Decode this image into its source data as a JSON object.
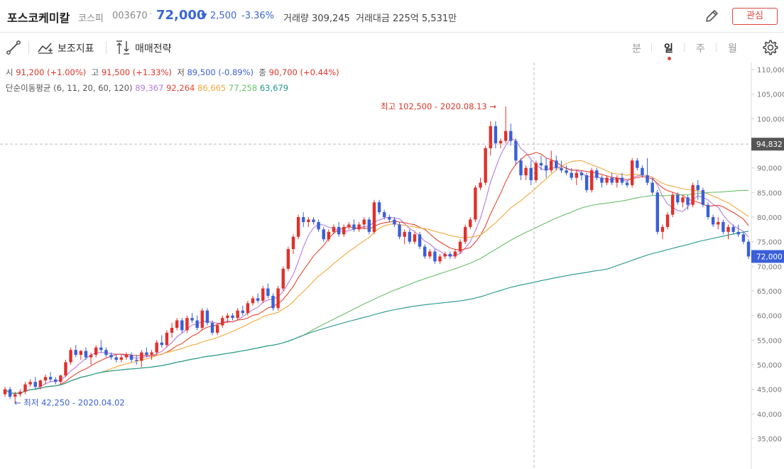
{
  "header": {
    "name": "포스코케미칼",
    "market": "코스피",
    "code": "003670",
    "separator": "·",
    "price": "72,000",
    "down_arrow": "▼",
    "change": "2,500",
    "change_pct": "-3.36%",
    "volume_label": "거래량",
    "volume": "309,245",
    "amount_label": "거래대금",
    "amount": "225억 5,531만",
    "favorite_label": "관심",
    "edit_icon": "pencil-icon"
  },
  "toolbar": {
    "draw_icon": "line-draw-icon",
    "indicator_label": "보조지표",
    "strategy_label": "매매전략",
    "periods": [
      {
        "label": "분",
        "selected": false
      },
      {
        "label": "일",
        "selected": true
      },
      {
        "label": "주",
        "selected": false
      },
      {
        "label": "월",
        "selected": false
      }
    ],
    "settings_icon": "gear-icon"
  },
  "ohlc": {
    "open_label": "시",
    "open": "91,200 (+1.00%)",
    "high_label": "고",
    "high": "91,500 (+1.33%)",
    "low_label": "저",
    "low": "89,500 (-0.89%)",
    "close_label": "종",
    "close": "90,700 (+0.44%)"
  },
  "ma": {
    "label": "단순이동평균 (6, 11, 20, 60, 120)",
    "values": [
      {
        "value": "89,367",
        "color": "#b57bde"
      },
      {
        "value": "92,264",
        "color": "#e8452e"
      },
      {
        "value": "86,665",
        "color": "#f2a93b"
      },
      {
        "value": "77,258",
        "color": "#6abf69"
      },
      {
        "value": "63,679",
        "color": "#1f968b"
      }
    ]
  },
  "colors": {
    "up": "#e0312b",
    "down": "#3a5fd8",
    "grid": "#e8e8e8"
  },
  "chart_data": {
    "type": "candlestick",
    "ylim": [
      34000,
      111000
    ],
    "yticks": [
      35000,
      40000,
      45000,
      50000,
      55000,
      60000,
      65000,
      70000,
      75000,
      80000,
      85000,
      90000,
      95000,
      100000,
      105000,
      110000
    ],
    "crosshair_price": 94832,
    "crosshair_label": "94,832",
    "last_price": 72000,
    "last_label": "72,000",
    "max_annotation": "최고 102,500 - 2020.08.13 →",
    "max_value": 102500,
    "min_annotation": "← 최저 42,250 - 2020.04.02",
    "min_value": 42250,
    "candles": [
      [
        44000,
        45500,
        43500,
        45000
      ],
      [
        45000,
        45500,
        43000,
        43500
      ],
      [
        43500,
        44500,
        42250,
        44000
      ],
      [
        44000,
        45000,
        43500,
        44500
      ],
      [
        44500,
        46500,
        44000,
        46000
      ],
      [
        46000,
        47000,
        45500,
        46500
      ],
      [
        46500,
        47500,
        45000,
        45500
      ],
      [
        45500,
        47000,
        45000,
        46800
      ],
      [
        46800,
        48000,
        46000,
        47500
      ],
      [
        47500,
        48500,
        46500,
        47000
      ],
      [
        47000,
        47500,
        46000,
        46500
      ],
      [
        46500,
        48000,
        46000,
        47800
      ],
      [
        47800,
        51000,
        47500,
        50500
      ],
      [
        50500,
        53500,
        50000,
        53000
      ],
      [
        53000,
        54000,
        51500,
        52000
      ],
      [
        52000,
        53000,
        51000,
        52800
      ],
      [
        52800,
        53500,
        51000,
        51500
      ],
      [
        51500,
        52500,
        50000,
        52000
      ],
      [
        52000,
        54000,
        51500,
        53500
      ],
      [
        53500,
        55000,
        52500,
        53000
      ],
      [
        53000,
        53500,
        51500,
        52000
      ],
      [
        52000,
        52500,
        51000,
        51500
      ],
      [
        51500,
        52000,
        50500,
        51000
      ],
      [
        51000,
        52000,
        50500,
        51500
      ],
      [
        51500,
        52500,
        51000,
        52000
      ],
      [
        52000,
        52500,
        50500,
        51000
      ],
      [
        51000,
        52000,
        50000,
        50800
      ],
      [
        50800,
        53000,
        49500,
        52500
      ],
      [
        52500,
        53500,
        51500,
        52000
      ],
      [
        52000,
        53000,
        51000,
        52500
      ],
      [
        52500,
        55000,
        52000,
        54500
      ],
      [
        54500,
        56000,
        53500,
        54000
      ],
      [
        54000,
        57000,
        53500,
        56500
      ],
      [
        56500,
        58500,
        55500,
        57500
      ],
      [
        57500,
        59500,
        57000,
        59000
      ],
      [
        59000,
        59500,
        56500,
        57000
      ],
      [
        57000,
        60000,
        56500,
        59500
      ],
      [
        59500,
        60500,
        58500,
        59000
      ],
      [
        59000,
        60000,
        57000,
        57500
      ],
      [
        57500,
        61500,
        57000,
        61000
      ],
      [
        61000,
        61500,
        58000,
        58500
      ],
      [
        58500,
        59000,
        56000,
        56500
      ],
      [
        56500,
        58500,
        56000,
        58000
      ],
      [
        58000,
        60000,
        57500,
        59500
      ],
      [
        59500,
        60500,
        58500,
        60000
      ],
      [
        60000,
        60500,
        59000,
        59500
      ],
      [
        59500,
        61500,
        59000,
        61000
      ],
      [
        61000,
        62000,
        60000,
        60500
      ],
      [
        60500,
        63000,
        60000,
        62500
      ],
      [
        62500,
        64000,
        62000,
        63500
      ],
      [
        63500,
        64500,
        62500,
        63000
      ],
      [
        63000,
        66000,
        62500,
        65500
      ],
      [
        65500,
        66500,
        63500,
        64000
      ],
      [
        64000,
        64500,
        61000,
        61500
      ],
      [
        61500,
        66000,
        61000,
        65500
      ],
      [
        65500,
        70000,
        65000,
        69500
      ],
      [
        69500,
        74000,
        69000,
        73500
      ],
      [
        73500,
        76500,
        72500,
        76000
      ],
      [
        76000,
        80500,
        75500,
        80000
      ],
      [
        80000,
        81000,
        78000,
        79000
      ],
      [
        79000,
        80000,
        78000,
        79500
      ],
      [
        79500,
        80000,
        78500,
        79000
      ],
      [
        79000,
        79500,
        77000,
        77500
      ],
      [
        77500,
        78000,
        75000,
        75500
      ],
      [
        75500,
        77500,
        75000,
        77000
      ],
      [
        77000,
        78500,
        76500,
        78000
      ],
      [
        78000,
        79000,
        76000,
        76500
      ],
      [
        76500,
        78500,
        76000,
        78000
      ],
      [
        78000,
        79000,
        77500,
        78500
      ],
      [
        78500,
        79500,
        77000,
        77500
      ],
      [
        77500,
        79000,
        77000,
        78500
      ],
      [
        78500,
        80000,
        77500,
        79500
      ],
      [
        79500,
        80000,
        76500,
        77000
      ],
      [
        77000,
        83500,
        76500,
        83000
      ],
      [
        83000,
        83500,
        80500,
        81000
      ],
      [
        81000,
        81500,
        79500,
        80000
      ],
      [
        80000,
        80500,
        79000,
        79500
      ],
      [
        79500,
        80000,
        78000,
        78500
      ],
      [
        78500,
        79000,
        75500,
        76000
      ],
      [
        76000,
        77500,
        74500,
        77000
      ],
      [
        77000,
        77500,
        74500,
        75000
      ],
      [
        75000,
        77000,
        74500,
        76500
      ],
      [
        76500,
        77000,
        73500,
        74000
      ],
      [
        74000,
        74500,
        71500,
        72000
      ],
      [
        72000,
        73500,
        71500,
        73000
      ],
      [
        73000,
        73500,
        70500,
        71000
      ],
      [
        71000,
        72500,
        70500,
        72000
      ],
      [
        72000,
        73000,
        71500,
        72500
      ],
      [
        72500,
        73000,
        71500,
        72000
      ],
      [
        72000,
        73500,
        71500,
        73000
      ],
      [
        73000,
        75500,
        72500,
        75000
      ],
      [
        75000,
        78500,
        74500,
        78000
      ],
      [
        78000,
        80000,
        77500,
        79500
      ],
      [
        79500,
        86500,
        79000,
        86000
      ],
      [
        86000,
        88000,
        85500,
        87000
      ],
      [
        87000,
        94500,
        86500,
        94000
      ],
      [
        94000,
        99500,
        92500,
        98500
      ],
      [
        98500,
        99500,
        94000,
        95000
      ],
      [
        95000,
        96000,
        94000,
        95500
      ],
      [
        95500,
        102500,
        95000,
        97500
      ],
      [
        97500,
        99000,
        94500,
        95500
      ],
      [
        95500,
        96000,
        90500,
        91500
      ],
      [
        91500,
        92000,
        87500,
        88500
      ],
      [
        88500,
        90500,
        87500,
        90000
      ],
      [
        90000,
        91500,
        86500,
        87500
      ],
      [
        87500,
        91500,
        87000,
        91000
      ],
      [
        91000,
        92500,
        89500,
        90500
      ],
      [
        90500,
        92000,
        88000,
        89500
      ],
      [
        89500,
        93500,
        89000,
        91500
      ],
      [
        91500,
        92500,
        89500,
        90000
      ],
      [
        90000,
        91500,
        89000,
        89500
      ],
      [
        89500,
        90500,
        88500,
        89000
      ],
      [
        89000,
        90000,
        87500,
        88000
      ],
      [
        88000,
        89500,
        86500,
        89000
      ],
      [
        89000,
        89500,
        87500,
        88500
      ],
      [
        88500,
        89000,
        85000,
        85500
      ],
      [
        85500,
        90000,
        85000,
        89500
      ],
      [
        89500,
        90000,
        87500,
        88000
      ],
      [
        88000,
        88500,
        86000,
        87000
      ],
      [
        87000,
        88500,
        86500,
        88000
      ],
      [
        88000,
        89000,
        86500,
        87000
      ],
      [
        87000,
        88500,
        86000,
        88000
      ],
      [
        88000,
        89000,
        86500,
        87000
      ],
      [
        87000,
        87500,
        86000,
        86500
      ],
      [
        86500,
        92000,
        86000,
        91500
      ],
      [
        91500,
        92000,
        89500,
        90000
      ],
      [
        90000,
        90500,
        88000,
        88500
      ],
      [
        88500,
        92000,
        86500,
        87000
      ],
      [
        87000,
        88000,
        84500,
        85000
      ],
      [
        85000,
        85500,
        76500,
        77000
      ],
      [
        77000,
        78500,
        75500,
        78000
      ],
      [
        78000,
        81000,
        77500,
        80500
      ],
      [
        80500,
        85000,
        80000,
        84500
      ],
      [
        84500,
        85000,
        82500,
        83000
      ],
      [
        83000,
        84500,
        82000,
        84000
      ],
      [
        84000,
        84500,
        81500,
        82500
      ],
      [
        82500,
        87000,
        82000,
        86500
      ],
      [
        86500,
        87500,
        83500,
        85500
      ],
      [
        85500,
        86000,
        82000,
        82500
      ],
      [
        82500,
        83000,
        79500,
        80000
      ],
      [
        80000,
        80500,
        78000,
        78500
      ],
      [
        78500,
        80000,
        77500,
        79000
      ],
      [
        79000,
        79500,
        76500,
        77000
      ],
      [
        77000,
        78500,
        75500,
        78000
      ],
      [
        78000,
        78500,
        76500,
        77000
      ],
      [
        77000,
        78500,
        76000,
        76500
      ],
      [
        76500,
        77000,
        74500,
        75000
      ],
      [
        75000,
        75500,
        71500,
        72000
      ]
    ],
    "ma6": [
      42300,
      43000,
      43800,
      44500,
      45200,
      46000,
      46800,
      47500,
      48200,
      49000,
      49700,
      50300,
      50800,
      51200,
      51500,
      51800,
      52000,
      52100,
      52200,
      52000,
      51800,
      51700,
      51600,
      51700,
      51900,
      52200,
      52600,
      53200,
      54000,
      54800,
      55600,
      56400,
      57200,
      57900,
      58400,
      58900,
      59400,
      60000,
      60800,
      61800,
      63000,
      64500,
      66500,
      69000,
      72000,
      75000,
      76800,
      77800,
      78300,
      78600,
      78600,
      78500,
      78500,
      78600,
      78800,
      79000,
      79300,
      79500,
      79400,
      79000,
      78400,
      77500,
      76500,
      75300,
      74200,
      73200,
      72800,
      72800,
      73200,
      74400,
      76400,
      79200,
      82500,
      86000,
      89800,
      93500,
      95600,
      95000,
      93300,
      91500,
      90600,
      90300,
      90500,
      90700,
      90400,
      90000,
      89500,
      89100,
      88800,
      88600,
      88400,
      88100,
      87900,
      87700,
      87500,
      87400,
      87500,
      87800,
      88100,
      88300,
      88300,
      87800,
      86700,
      85100,
      83500,
      82400,
      82100,
      82300,
      83200,
      84100,
      84500,
      84100,
      83300,
      82300,
      81000,
      79800,
      78800,
      78100,
      77500,
      76900,
      75800
    ]
  }
}
